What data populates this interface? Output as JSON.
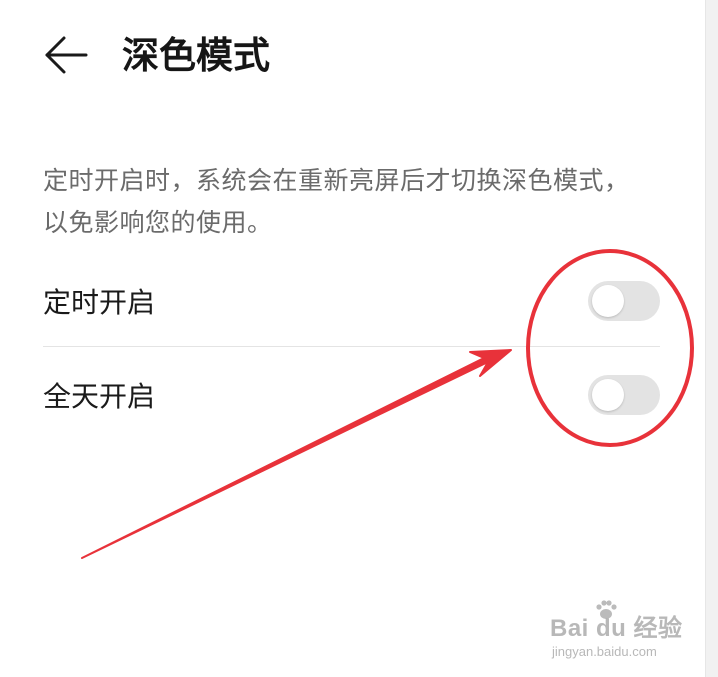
{
  "header": {
    "back_icon": "arrow-left-icon",
    "title": "深色模式"
  },
  "description": "定时开启时，系统会在重新亮屏后才切换深色模式，以免影响您的使用。",
  "settings": [
    {
      "label": "定时开启",
      "enabled": false
    },
    {
      "label": "全天开启",
      "enabled": false
    }
  ],
  "colors": {
    "annotation_red": "#e8323a",
    "toggle_off": "#e3e3e3"
  },
  "watermark": {
    "text": "Bai du 经验",
    "url_text": "jingyan.baidu.com"
  }
}
